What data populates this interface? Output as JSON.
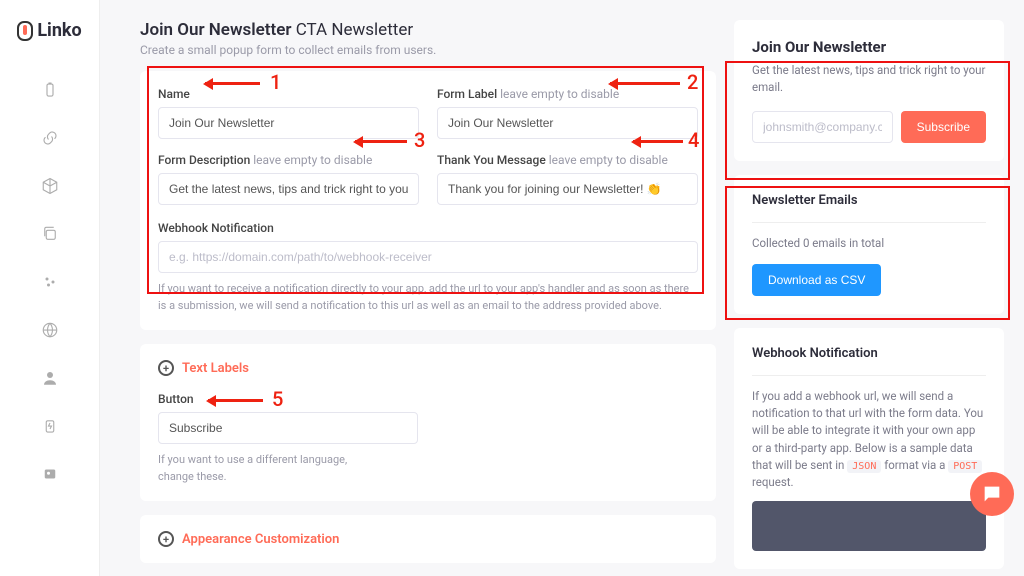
{
  "brand": "Linko",
  "page": {
    "title_main": "Join Our Newsletter",
    "title_suffix": "CTA Newsletter",
    "subtitle": "Create a small popup form to collect emails from users."
  },
  "fields": {
    "name": {
      "label": "Name",
      "value": "Join Our Newsletter"
    },
    "form_label": {
      "label": "Form Label",
      "hint": "leave empty to disable",
      "value": "Join Our Newsletter"
    },
    "form_description": {
      "label": "Form Description",
      "hint": "leave empty to disable",
      "value": "Get the latest news, tips and trick right to your email."
    },
    "thank_you": {
      "label": "Thank You Message",
      "hint": "leave empty to disable",
      "value": "Thank you for joining our Newsletter! 👏"
    },
    "webhook": {
      "label": "Webhook Notification",
      "placeholder": "e.g. https://domain.com/path/to/webhook-receiver",
      "help": "If you want to receive a notification directly to your app, add the url to your app's handler and as soon as there is a submission, we will send a notification to this url as well as an email to the address provided above."
    }
  },
  "sections": {
    "text_labels": {
      "title": "Text Labels",
      "button_label": "Button",
      "button_value": "Subscribe",
      "help": "If you want to use a different language, change these."
    },
    "appearance": {
      "title": "Appearance Customization"
    }
  },
  "preview": {
    "heading": "Join Our Newsletter",
    "text": "Get the latest news, tips and trick right to your email.",
    "placeholder": "johnsmith@company.com",
    "button": "Subscribe"
  },
  "emails_panel": {
    "title": "Newsletter Emails",
    "count_text": "Collected 0 emails in total",
    "button": "Download as CSV"
  },
  "webhook_panel": {
    "title": "Webhook Notification",
    "text_before": "If you add a webhook url, we will send a notification to that url with the form data. You will be able to integrate it with your own app or a third-party app. Below is a sample data that will be sent in ",
    "code1": "JSON",
    "text_mid": " format via a ",
    "code2": "POST",
    "text_after": " request."
  },
  "annotations": {
    "1": "1",
    "2": "2",
    "3": "3",
    "4": "4",
    "5": "5"
  }
}
